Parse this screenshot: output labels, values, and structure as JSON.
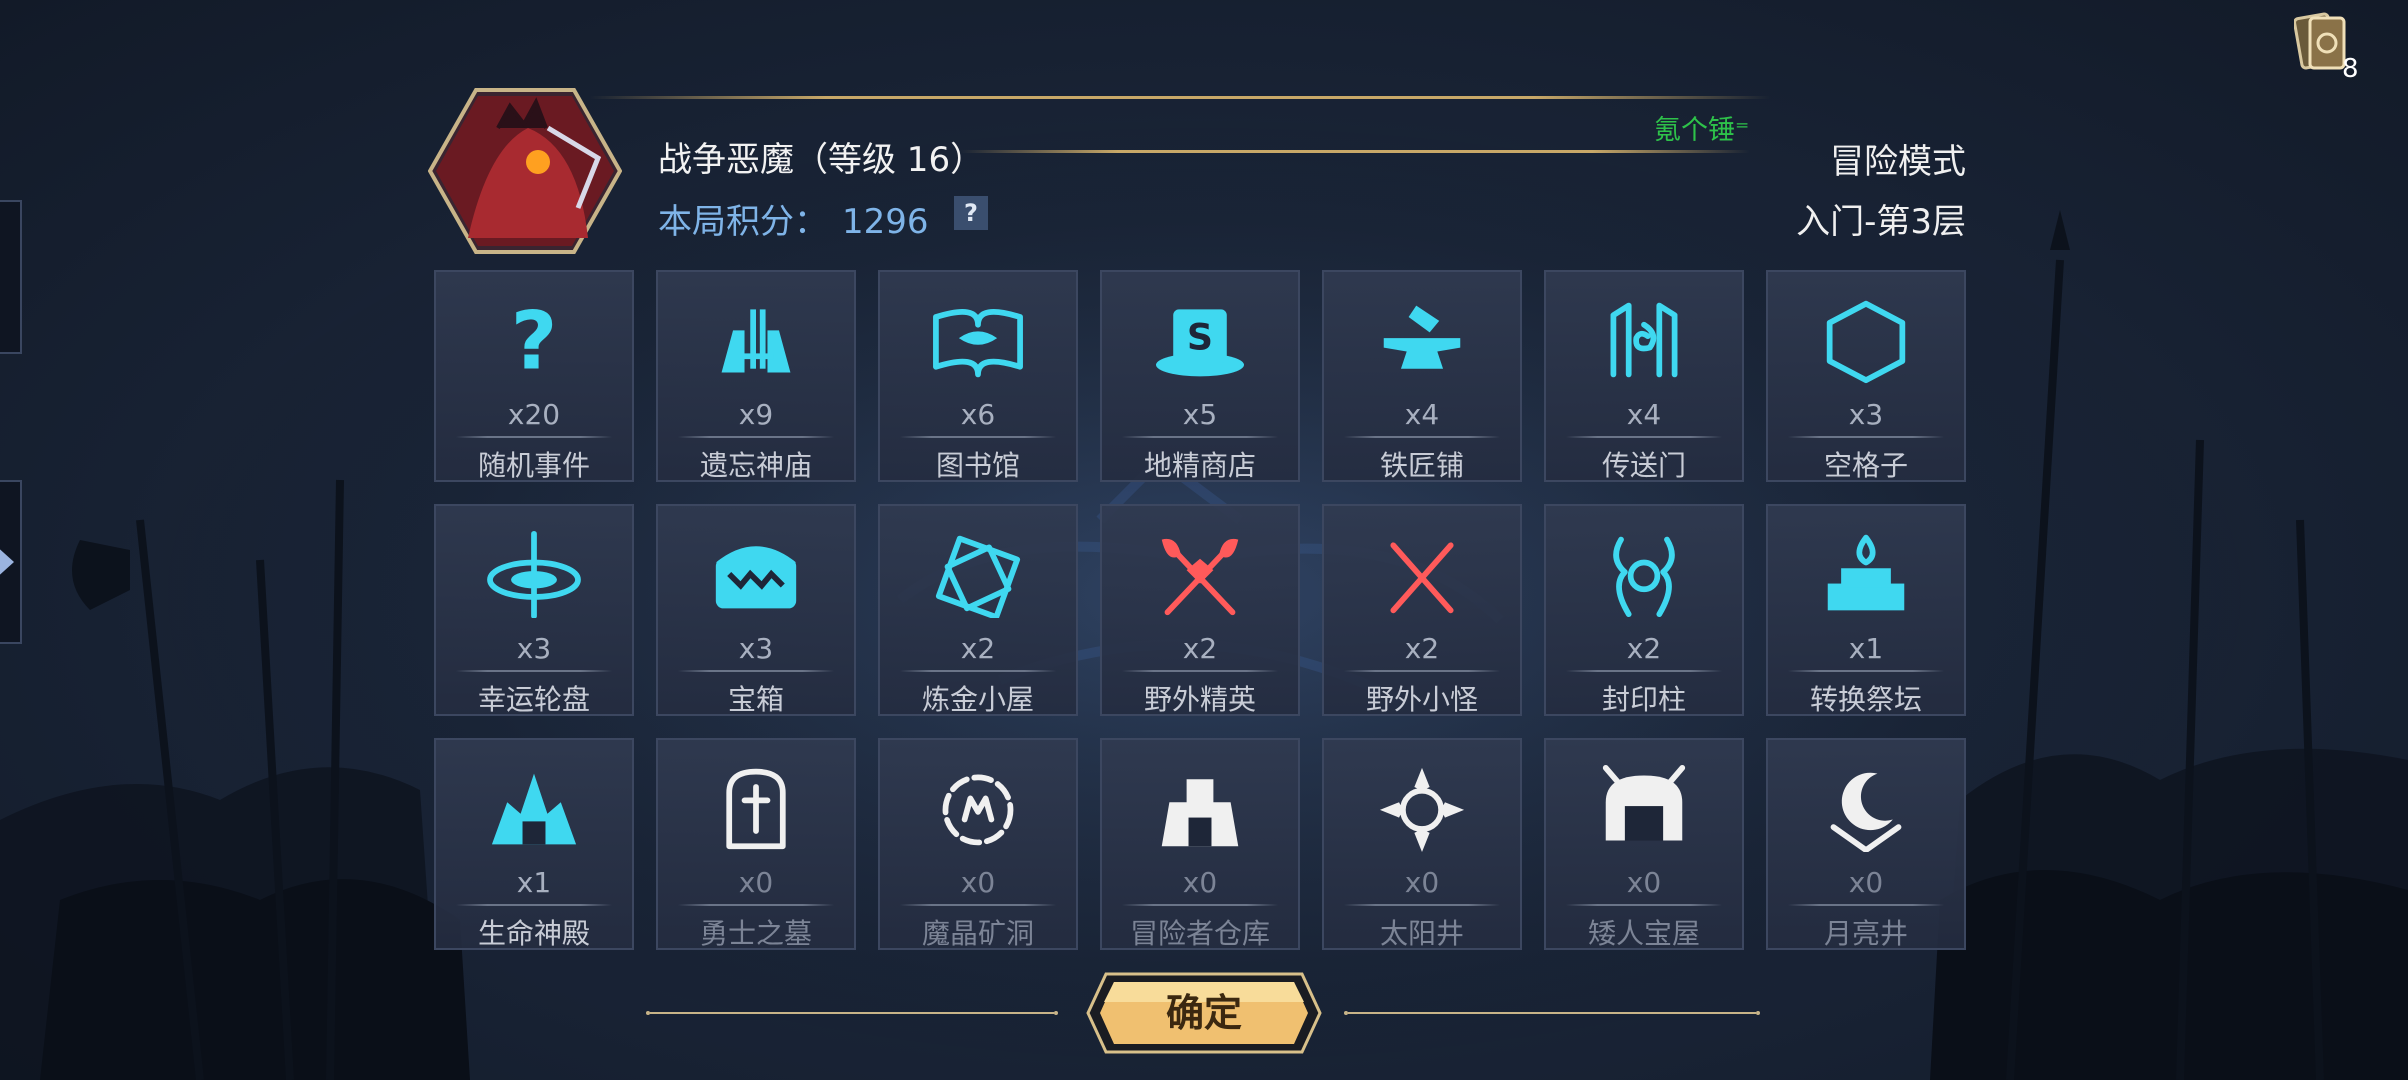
{
  "header": {
    "boss_name": "战争恶魔（等级 16）",
    "score_label": "本局积分：",
    "score_value": "1296",
    "help_icon": "?",
    "green_tag": "氪个锤⁼",
    "mode": "冒险模式",
    "floor": "入门-第3层",
    "deck_count": "8",
    "avatar_icon": "war-demon-avatar"
  },
  "tiles": [
    {
      "icon": "question-icon",
      "count": "x20",
      "name": "随机事件",
      "color": "#3fd8f0"
    },
    {
      "icon": "temple-icon",
      "count": "x9",
      "name": "遗忘神庙",
      "color": "#3fd8f0"
    },
    {
      "icon": "book-icon",
      "count": "x6",
      "name": "图书馆",
      "color": "#3fd8f0"
    },
    {
      "icon": "shop-hat-icon",
      "count": "x5",
      "name": "地精商店",
      "color": "#3fd8f0"
    },
    {
      "icon": "anvil-icon",
      "count": "x4",
      "name": "铁匠铺",
      "color": "#3fd8f0"
    },
    {
      "icon": "portal-icon",
      "count": "x4",
      "name": "传送门",
      "color": "#3fd8f0"
    },
    {
      "icon": "hexagon-icon",
      "count": "x3",
      "name": "空格子",
      "color": "#3fd8f0"
    },
    {
      "icon": "wheel-icon",
      "count": "x3",
      "name": "幸运轮盘",
      "color": "#3fd8f0"
    },
    {
      "icon": "chest-icon",
      "count": "x3",
      "name": "宝箱",
      "color": "#3fd8f0"
    },
    {
      "icon": "alchemy-icon",
      "count": "x2",
      "name": "炼金小屋",
      "color": "#3fd8f0"
    },
    {
      "icon": "crossed-axes-icon",
      "count": "x2",
      "name": "野外精英",
      "color": "#ff5a5a"
    },
    {
      "icon": "crossed-swords-icon",
      "count": "x2",
      "name": "野外小怪",
      "color": "#ff5a5a"
    },
    {
      "icon": "seal-pillar-icon",
      "count": "x2",
      "name": "封印柱",
      "color": "#3fd8f0"
    },
    {
      "icon": "altar-icon",
      "count": "x1",
      "name": "转换祭坛",
      "color": "#3fd8f0"
    },
    {
      "icon": "life-temple-icon",
      "count": "x1",
      "name": "生命神殿",
      "color": "#3fd8f0"
    },
    {
      "icon": "tombstone-icon",
      "count": "x0",
      "name": "勇士之墓",
      "color": "#f0f0f0"
    },
    {
      "icon": "crystal-mine-icon",
      "count": "x0",
      "name": "魔晶矿洞",
      "color": "#f0f0f0"
    },
    {
      "icon": "warehouse-icon",
      "count": "x0",
      "name": "冒险者仓库",
      "color": "#f0f0f0"
    },
    {
      "icon": "sun-well-icon",
      "count": "x0",
      "name": "太阳井",
      "color": "#f0f0f0"
    },
    {
      "icon": "dwarf-house-icon",
      "count": "x0",
      "name": "矮人宝屋",
      "color": "#f0f0f0"
    },
    {
      "icon": "moon-well-icon",
      "count": "x0",
      "name": "月亮井",
      "color": "#f0f0f0"
    }
  ],
  "confirm": {
    "label": "确定"
  },
  "colors": {
    "accent_cyan": "#3fd8f0",
    "enemy_red": "#ff5a5a",
    "score_blue": "#7fb4e8",
    "gold": "#c8a868",
    "green": "#2ec24a"
  }
}
